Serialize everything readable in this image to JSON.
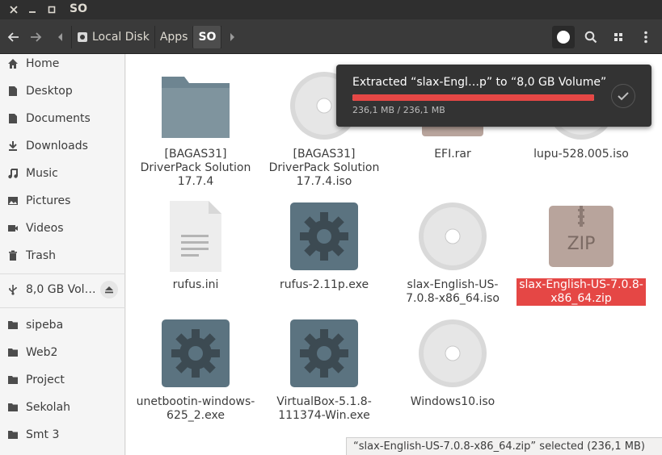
{
  "window": {
    "title": "SO"
  },
  "toolbar": {
    "breadcrumbs": [
      {
        "label": "Local Disk"
      },
      {
        "label": "Apps"
      },
      {
        "label": "SO"
      }
    ]
  },
  "sidebar": {
    "places": [
      {
        "label": "Home",
        "icon": "home-icon"
      },
      {
        "label": "Desktop",
        "icon": "desktop-icon"
      },
      {
        "label": "Documents",
        "icon": "documents-icon"
      },
      {
        "label": "Downloads",
        "icon": "download-icon"
      },
      {
        "label": "Music",
        "icon": "music-icon"
      },
      {
        "label": "Pictures",
        "icon": "pictures-icon"
      },
      {
        "label": "Videos",
        "icon": "videos-icon"
      },
      {
        "label": "Trash",
        "icon": "trash-icon"
      }
    ],
    "devices": [
      {
        "label": "8,0 GB Vol…",
        "icon": "usb-icon"
      }
    ],
    "bookmarks": [
      {
        "label": "sipeba"
      },
      {
        "label": "Web2"
      },
      {
        "label": "Project"
      },
      {
        "label": "Sekolah"
      },
      {
        "label": "Smt 3"
      }
    ]
  },
  "files": [
    {
      "name": "[BAGAS31] DriverPack Solution 17.7.4",
      "type": "folder"
    },
    {
      "name": "[BAGAS31] DriverPack Solution 17.7.4.iso",
      "type": "disc"
    },
    {
      "name": "EFI.rar",
      "type": "archive"
    },
    {
      "name": "lupu-528.005.iso",
      "type": "disc"
    },
    {
      "name": "rufus.ini",
      "type": "text"
    },
    {
      "name": "rufus-2.11p.exe",
      "type": "exe"
    },
    {
      "name": "slax-English-US-7.0.8-x86_64.iso",
      "type": "disc"
    },
    {
      "name": "slax-English-US-7.0.8-x86_64.zip",
      "type": "zip",
      "selected": true
    },
    {
      "name": "unetbootin-windows-625_2.exe",
      "type": "exe"
    },
    {
      "name": "VirtualBox-5.1.8-111374-Win.exe",
      "type": "exe"
    },
    {
      "name": "Windows10.iso",
      "type": "disc"
    }
  ],
  "notification": {
    "title": "Extracted “slax-Engl…p” to “8,0 GB Volume”",
    "size": "236,1 MB / 236,1 MB",
    "progress": 1.0
  },
  "status": {
    "text": "“slax-English-US-7.0.8-x86_64.zip” selected  (236,1 MB)"
  },
  "zip_label": "ZIP",
  "colors": {
    "accent": "#e95420",
    "progress": "#e54745",
    "selection_label": "#e54745"
  }
}
